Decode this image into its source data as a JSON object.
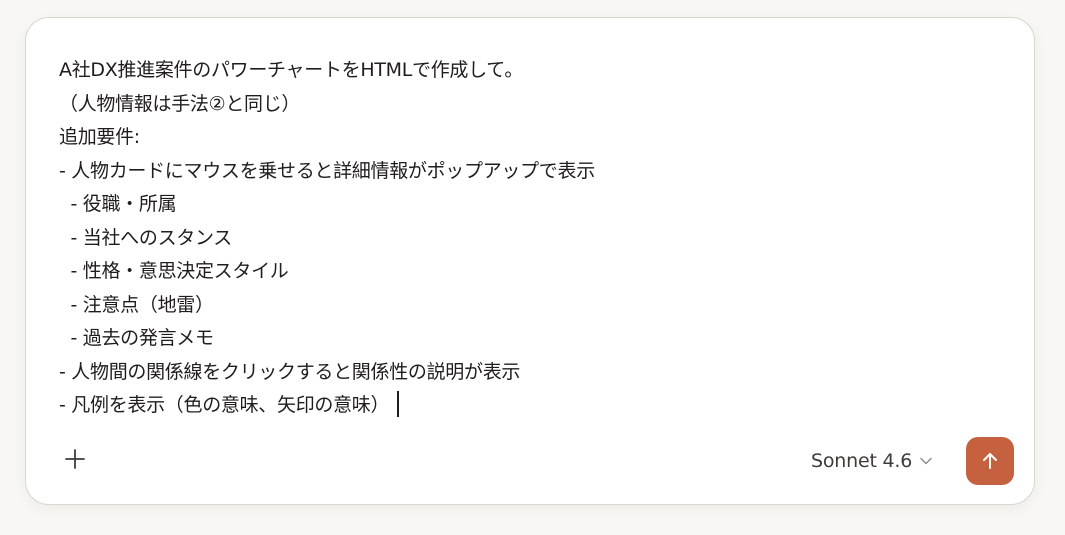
{
  "composer": {
    "lines": [
      "A社DX推進案件のパワーチャートをHTMLで作成して。",
      "（人物情報は手法②と同じ）",
      "追加要件:",
      "- 人物カードにマウスを乗せると詳細情報がポップアップで表示",
      "  - 役職・所属",
      "  - 当社へのスタンス",
      "  - 性格・意思決定スタイル",
      "  - 注意点（地雷）",
      "  - 過去の発言メモ",
      "- 人物間の関係線をクリックすると関係性の説明が表示",
      "- 凡例を表示（色の意味、矢印の意味）"
    ]
  },
  "toolbar": {
    "add_icon": "plus-icon",
    "model_label": "Sonnet 4.6",
    "model_dropdown_icon": "chevron-down-icon",
    "send_icon": "arrow-up-icon"
  },
  "colors": {
    "page_background": "#f8f7f3",
    "composer_background": "#ffffff",
    "text": "#1f1e1d",
    "send_button": "#c6613f"
  }
}
